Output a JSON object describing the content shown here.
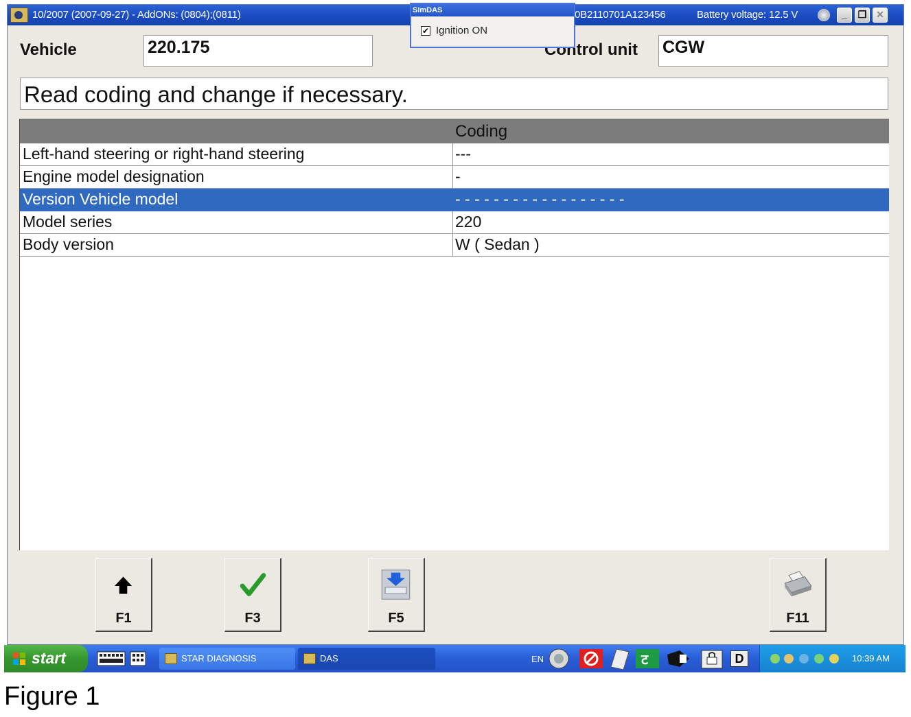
{
  "window": {
    "title": "10/2007 (2007-09-27) - AddONs: (0804);(0811)",
    "serial": "0B2110701A123456",
    "battery": "Battery voltage: 12.5 V",
    "minimize_glyph": "_",
    "maximize_glyph": "❐",
    "close_glyph": "✕"
  },
  "simdas": {
    "title": "SimDAS",
    "ignition_label": "Ignition ON",
    "ignition_checked": true,
    "check_glyph": "✔"
  },
  "header": {
    "vehicle_label": "Vehicle",
    "vehicle_value": "220.175",
    "control_unit_label": "Control unit",
    "control_unit_value": "CGW"
  },
  "instruction": "Read coding and change if necessary.",
  "table": {
    "column_header": "Coding",
    "rows": [
      {
        "label": "Left-hand steering or right-hand steering",
        "value": "---"
      },
      {
        "label": "Engine model designation",
        "value": "-"
      },
      {
        "label": "Version Vehicle model",
        "value": "- - - - - - - - - - - - - - - - - -",
        "selected": true
      },
      {
        "label": "Model series",
        "value": "220"
      },
      {
        "label": "Body version",
        "value": "W ( Sedan )"
      }
    ]
  },
  "function_keys": [
    {
      "label": "F1",
      "icon": "up-arrow-icon"
    },
    {
      "label": "F3",
      "icon": "checkmark-icon"
    },
    {
      "label": "F5",
      "icon": "download-icon"
    },
    {
      "label": "F11",
      "icon": "printer-icon"
    }
  ],
  "taskbar": {
    "start_label": "start",
    "tasks": [
      {
        "label": "STAR DIAGNOSIS"
      },
      {
        "label": "DAS"
      }
    ],
    "language": "EN",
    "tray_letter": "D",
    "clock": "10:39 AM"
  },
  "caption": "Figure 1",
  "colors": {
    "selection": "#2f6ac0",
    "header_bar": "#7c7c7c",
    "titlebar": "#1a4bc0",
    "window_bg": "#ebe9e1",
    "start_button": "#36962e"
  }
}
